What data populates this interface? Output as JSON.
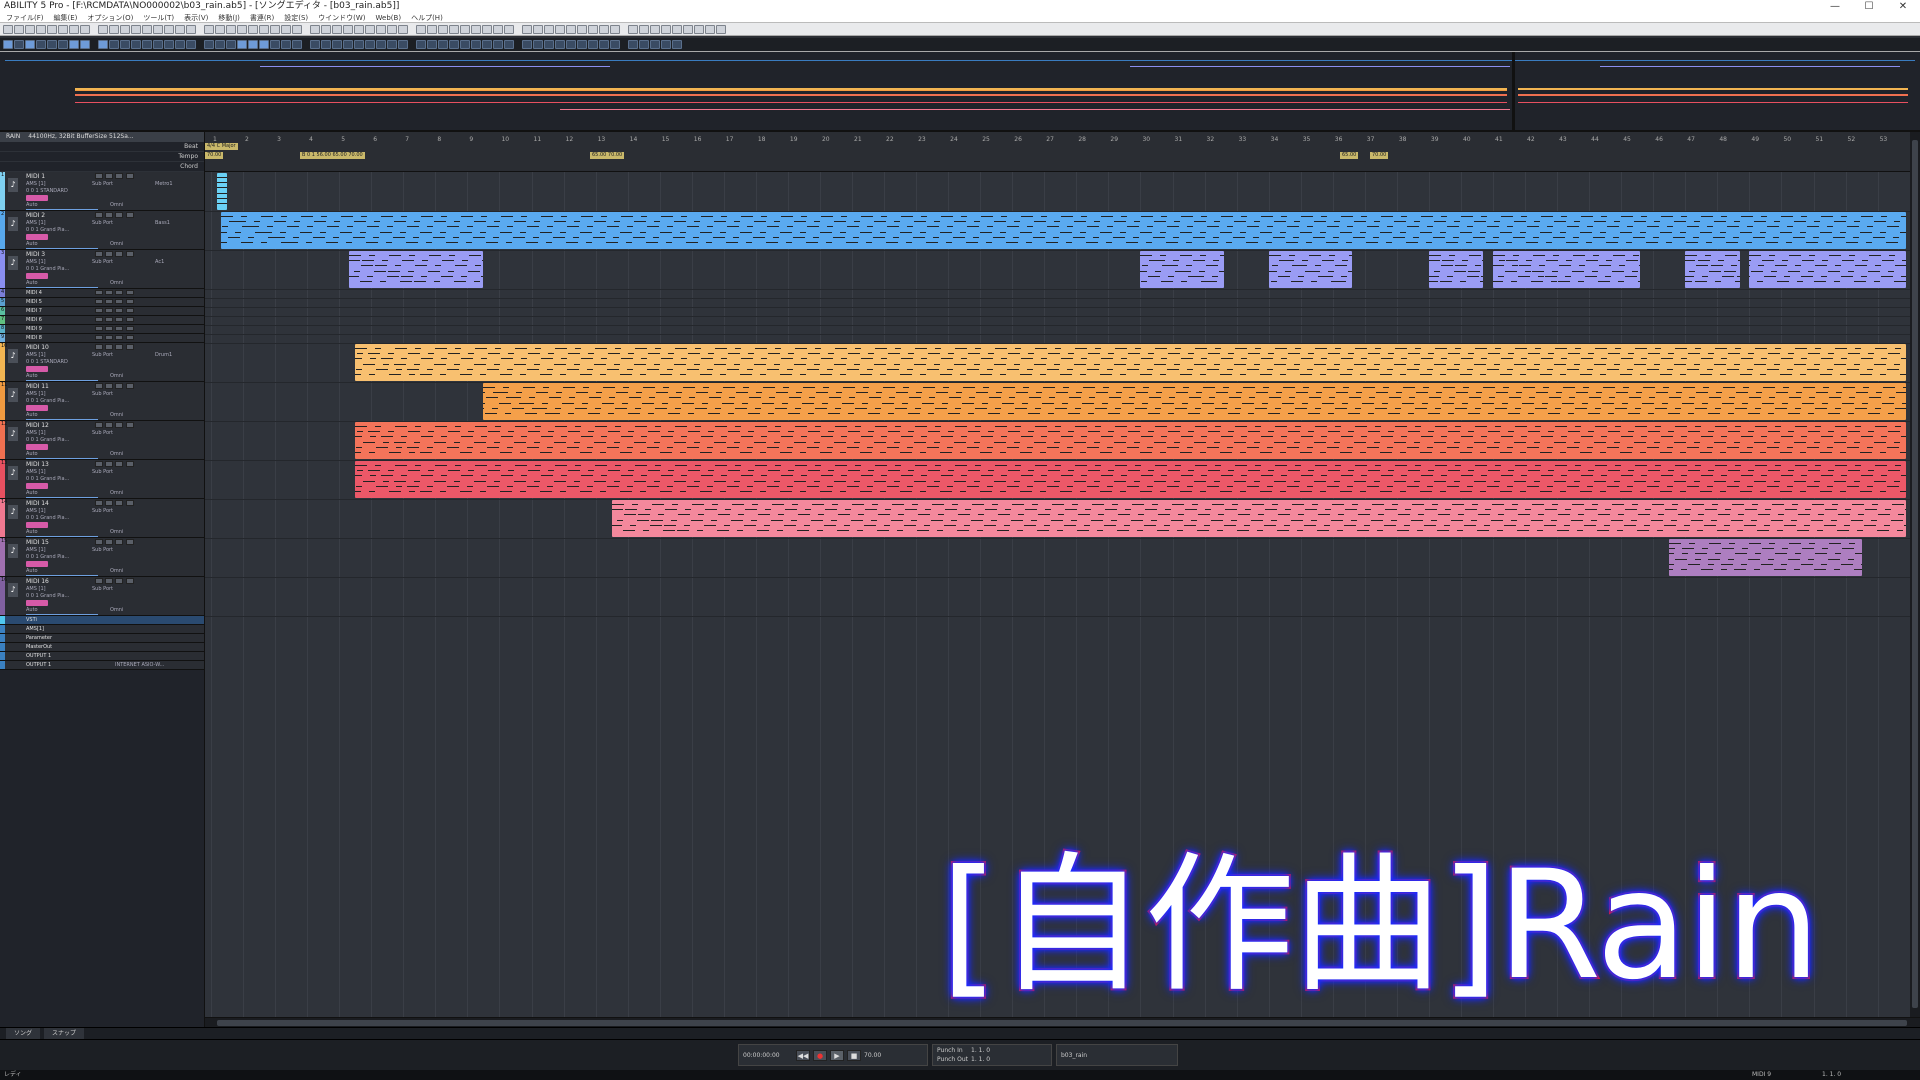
{
  "window": {
    "title": "ABILITY 5 Pro - [F:\\RCMDATA\\NO000002\\b03_rain.ab5] - [ソングエディタ - [b03_rain.ab5]]",
    "controls": [
      "—",
      "☐",
      "✕"
    ]
  },
  "menu": [
    "ファイル(F)",
    "編集(E)",
    "オプション(O)",
    "ツール(T)",
    "表示(V)",
    "移動(J)",
    "書連(R)",
    "設定(S)",
    "ウインドウ(W)",
    "Web(B)",
    "ヘルプ(H)"
  ],
  "song": {
    "name": "RAIN",
    "audio_info": "44100Hz, 32Bit BufferSize 512Sa..."
  },
  "ruler": {
    "rows": [
      "Beat",
      "Tempo",
      "Chord"
    ],
    "bars": [
      "1",
      "2",
      "3",
      "4",
      "5",
      "6",
      "7",
      "8",
      "9",
      "10",
      "11",
      "12",
      "13",
      "14",
      "15",
      "16",
      "17",
      "18",
      "19",
      "20",
      "21",
      "22",
      "23",
      "24",
      "25",
      "26",
      "27",
      "28",
      "29",
      "30",
      "31",
      "32",
      "33",
      "34",
      "35",
      "36",
      "37",
      "38",
      "39",
      "40",
      "41",
      "42",
      "43",
      "44",
      "45",
      "46",
      "47",
      "48",
      "49",
      "50",
      "51",
      "52",
      "53"
    ],
    "markers": [
      {
        "label": "4/4 C Major"
      },
      {
        "label": "70.00"
      },
      {
        "label": "B 0 1 56.00 65.00 70.00"
      },
      {
        "label": "65.00 70.00"
      },
      {
        "label": "65.00"
      },
      {
        "label": "70.00"
      }
    ]
  },
  "tracks": [
    {
      "num": "1",
      "name": "MIDI 1",
      "port": "AMS [1]",
      "device": "Sub Port",
      "inst": "Metro1",
      "patch": "0 0 1 STANDARD",
      "auto": "Auto",
      "omni": "Omni",
      "color": "#7fd0f0"
    },
    {
      "num": "2",
      "name": "MIDI 2",
      "port": "AMS [1]",
      "device": "Sub Port",
      "inst": "Bass1",
      "patch": "0 0 1 Grand Pia...",
      "auto": "Auto",
      "omni": "Omni",
      "color": "#58a8ec"
    },
    {
      "num": "3",
      "name": "MIDI 3",
      "port": "AMS [1]",
      "device": "Sub Port",
      "inst": "Ac1",
      "patch": "0 0 1 Grand Pia...",
      "auto": "Auto",
      "omni": "Omni",
      "color": "#8a8ef0"
    },
    {
      "num": "4",
      "name": "MIDI 4",
      "color": "#7a7ed8"
    },
    {
      "num": "5",
      "name": "MIDI 5",
      "color": "#5aa0d0"
    },
    {
      "num": "6",
      "name": "MIDI 7",
      "color": "#5ac0a0"
    },
    {
      "num": "7",
      "name": "MIDI 6",
      "color": "#60c080"
    },
    {
      "num": "8",
      "name": "MIDI 9",
      "color": "#5ab0c8"
    },
    {
      "num": "9",
      "name": "MIDI 8",
      "color": "#70b0e0"
    },
    {
      "num": "10",
      "name": "MIDI 10",
      "port": "AMS [1]",
      "device": "Sub Port",
      "inst": "Drum1",
      "patch": "0 0 1 STANDARD",
      "auto": "Auto",
      "omni": "Omni",
      "color": "#f2b552"
    },
    {
      "num": "11",
      "name": "MIDI 11",
      "port": "AMS [1]",
      "device": "Sub Port",
      "patch": "0 0 1 Grand Pia...",
      "auto": "Auto",
      "omni": "Omni",
      "color": "#f09a40"
    },
    {
      "num": "12",
      "name": "MIDI 12",
      "port": "AMS [1]",
      "device": "Sub Port",
      "patch": "0 0 1 Grand Pia...",
      "auto": "Auto",
      "omni": "Omni",
      "color": "#f07050"
    },
    {
      "num": "13",
      "name": "MIDI 13",
      "port": "AMS [1]",
      "device": "Sub Port",
      "patch": "0 0 1 Grand Pia...",
      "auto": "Auto",
      "omni": "Omni",
      "color": "#e85060"
    },
    {
      "num": "14",
      "name": "MIDI 14",
      "port": "AMS [1]",
      "device": "Sub Port",
      "patch": "0 0 1 Grand Pia...",
      "auto": "Auto",
      "omni": "Omni",
      "color": "#f07890"
    },
    {
      "num": "15",
      "name": "MIDI 15",
      "port": "AMS [1]",
      "device": "Sub Port",
      "patch": "0 0 1 Grand Pia...",
      "auto": "Auto",
      "omni": "Omni",
      "color": "#a070b0"
    },
    {
      "num": "16",
      "name": "MIDI 16",
      "port": "AMS [1]",
      "device": "Sub Port",
      "patch": "0 0 1 Grand Pia...",
      "auto": "Auto",
      "omni": "Omni",
      "color": "#8060a0"
    }
  ],
  "bus_tracks": [
    {
      "label": "VSTi"
    },
    {
      "label": "AMS[1]"
    },
    {
      "label": "Parameter"
    },
    {
      "label": "MasterOut"
    },
    {
      "label": "OUTPUT 1"
    },
    {
      "label": "OUTPUT 1",
      "device": "INTERNET ASIO-W..."
    }
  ],
  "clips": [
    {
      "track": 1,
      "startBar": 1.2,
      "endBar": 1.5,
      "color": "#6ad0f4"
    },
    {
      "track": 2,
      "startBar": 1.3,
      "endBar": 53.9,
      "color": "#5aaaf0"
    },
    {
      "track": 3,
      "startBar": 5.3,
      "endBar": 9.5,
      "color": "#9a9cf4"
    },
    {
      "track": 3,
      "startBar": 30.0,
      "endBar": 32.6,
      "color": "#9a9cf4"
    },
    {
      "track": 3,
      "startBar": 34.0,
      "endBar": 36.6,
      "color": "#9a9cf4"
    },
    {
      "track": 3,
      "startBar": 39.0,
      "endBar": 40.7,
      "color": "#9a9cf4"
    },
    {
      "track": 3,
      "startBar": 41.0,
      "endBar": 45.6,
      "color": "#9a9cf4"
    },
    {
      "track": 3,
      "startBar": 47.0,
      "endBar": 48.7,
      "color": "#9a9cf4"
    },
    {
      "track": 3,
      "startBar": 49.0,
      "endBar": 53.9,
      "color": "#9a9cf4"
    },
    {
      "track": 10,
      "startBar": 5.5,
      "endBar": 53.9,
      "color": "#f8c070"
    },
    {
      "track": 11,
      "startBar": 9.5,
      "endBar": 53.9,
      "color": "#f5a04a"
    },
    {
      "track": 12,
      "startBar": 5.5,
      "endBar": 53.9,
      "color": "#f4745a"
    },
    {
      "track": 13,
      "startBar": 5.5,
      "endBar": 53.9,
      "color": "#ec5868"
    },
    {
      "track": 14,
      "startBar": 13.5,
      "endBar": 53.9,
      "color": "#f4889c"
    },
    {
      "track": 15,
      "startBar": 46.5,
      "endBar": 52.5,
      "color": "#ad7ec0"
    }
  ],
  "bottom_tabs": [
    "ソング",
    "スナップ"
  ],
  "transport": {
    "position": "00:00:00:00",
    "tempo": "70.00",
    "punch_in": "Punch In",
    "punch_out": "Punch Out",
    "pos_a": "1. 1. 0",
    "pos_b": "1. 1. 0",
    "song_file": "b03_rain"
  },
  "status": {
    "left": "レディ",
    "midi": "MIDI 9",
    "pos": "1. 1. 0"
  },
  "overlay": {
    "title": "[自作曲]Rain"
  }
}
